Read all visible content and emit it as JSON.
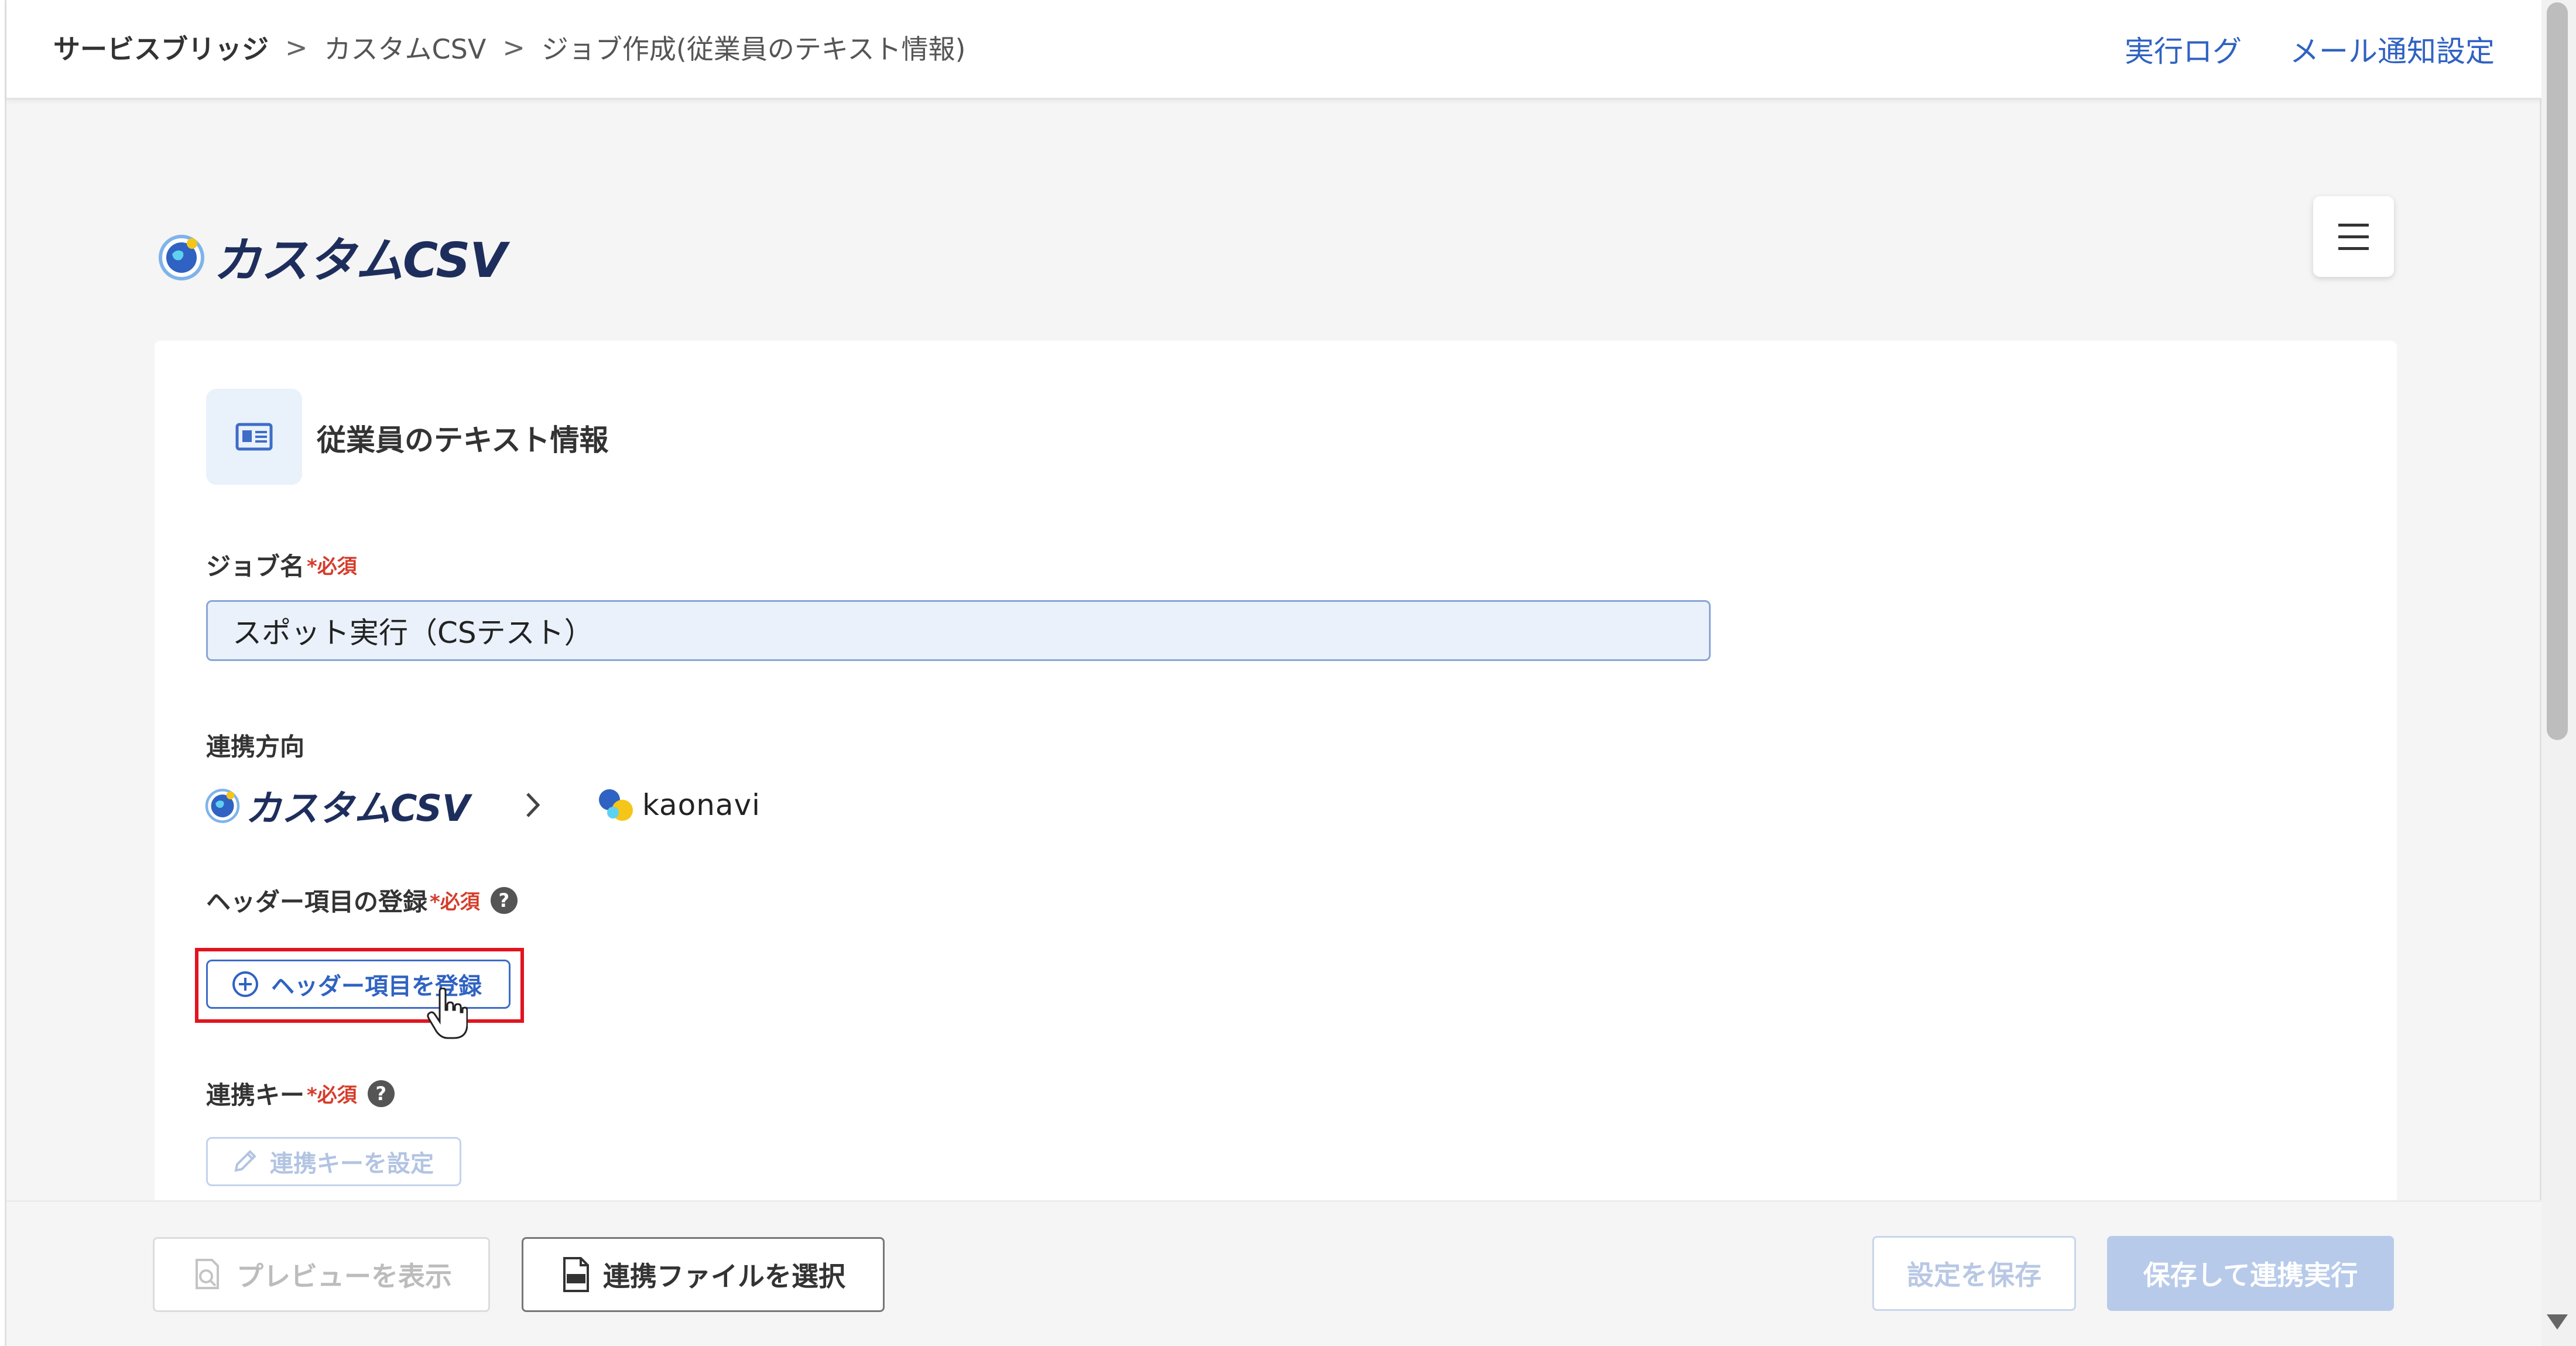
{
  "breadcrumb": {
    "items": [
      "サービスブリッジ",
      "カスタムCSV",
      "ジョブ作成(従業員のテキスト情報)"
    ],
    "separator": ">"
  },
  "header_links": {
    "log": "実行ログ",
    "mail": "メール通知設定"
  },
  "logo": {
    "brand": "カスタムCSV",
    "icon": "globe-icon"
  },
  "menu_icon": "hamburger-icon",
  "section": {
    "title": "従業員のテキスト情報",
    "icon": "id-card-icon"
  },
  "job_name": {
    "label": "ジョブ名",
    "required_mark": "*",
    "required_text": "必須",
    "value": "スポット実行（CSテスト）"
  },
  "direction": {
    "label": "連携方向",
    "from": "カスタムCSV",
    "to": "kaonavi"
  },
  "header_items": {
    "label": "ヘッダー項目の登録",
    "required_mark": "*",
    "required_text": "必須",
    "help": "?",
    "button": "ヘッダー項目を登録"
  },
  "link_key": {
    "label": "連携キー",
    "required_mark": "*",
    "required_text": "必須",
    "help": "?",
    "button": "連携キーを設定"
  },
  "footer": {
    "preview": "プレビューを表示",
    "select_file": "連携ファイルを選択",
    "save": "設定を保存",
    "save_run": "保存して連携実行"
  },
  "colors": {
    "accent": "#2f62c2",
    "required": "#d63b2a",
    "highlight": "#e0141e",
    "disabled_primary": "#b7caea"
  }
}
